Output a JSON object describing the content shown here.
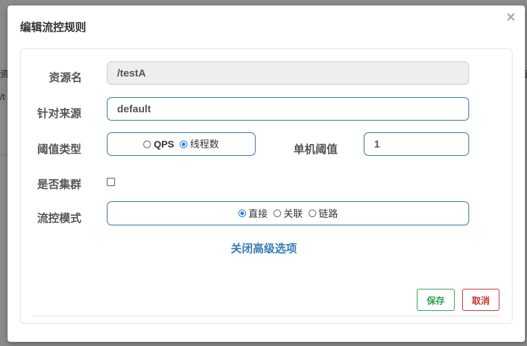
{
  "background": {
    "col1_label": "资",
    "col1_value": "/t",
    "right_label": "值"
  },
  "dialog": {
    "title": "编辑流控规则",
    "close_glyph": "×"
  },
  "form": {
    "resource_label": "资源名",
    "resource_value": "/testA",
    "origin_label": "针对来源",
    "origin_value": "default",
    "threshold_type_label": "阈值类型",
    "threshold_type_options": [
      {
        "label": "QPS",
        "checked": false
      },
      {
        "label": "线程数",
        "checked": true
      }
    ],
    "single_threshold_label": "单机阈值",
    "single_threshold_value": "1",
    "cluster_label": "是否集群",
    "cluster_checked": false,
    "flow_mode_label": "流控模式",
    "flow_mode_options": [
      {
        "label": "直接",
        "checked": true
      },
      {
        "label": "关联",
        "checked": false
      },
      {
        "label": "链路",
        "checked": false
      }
    ],
    "advanced_toggle": "关闭高级选项"
  },
  "footer": {
    "save_label": "保存",
    "cancel_label": "取消"
  },
  "colors": {
    "accent": "#337ab7",
    "save": "#2aa44f",
    "cancel": "#c9302c"
  }
}
